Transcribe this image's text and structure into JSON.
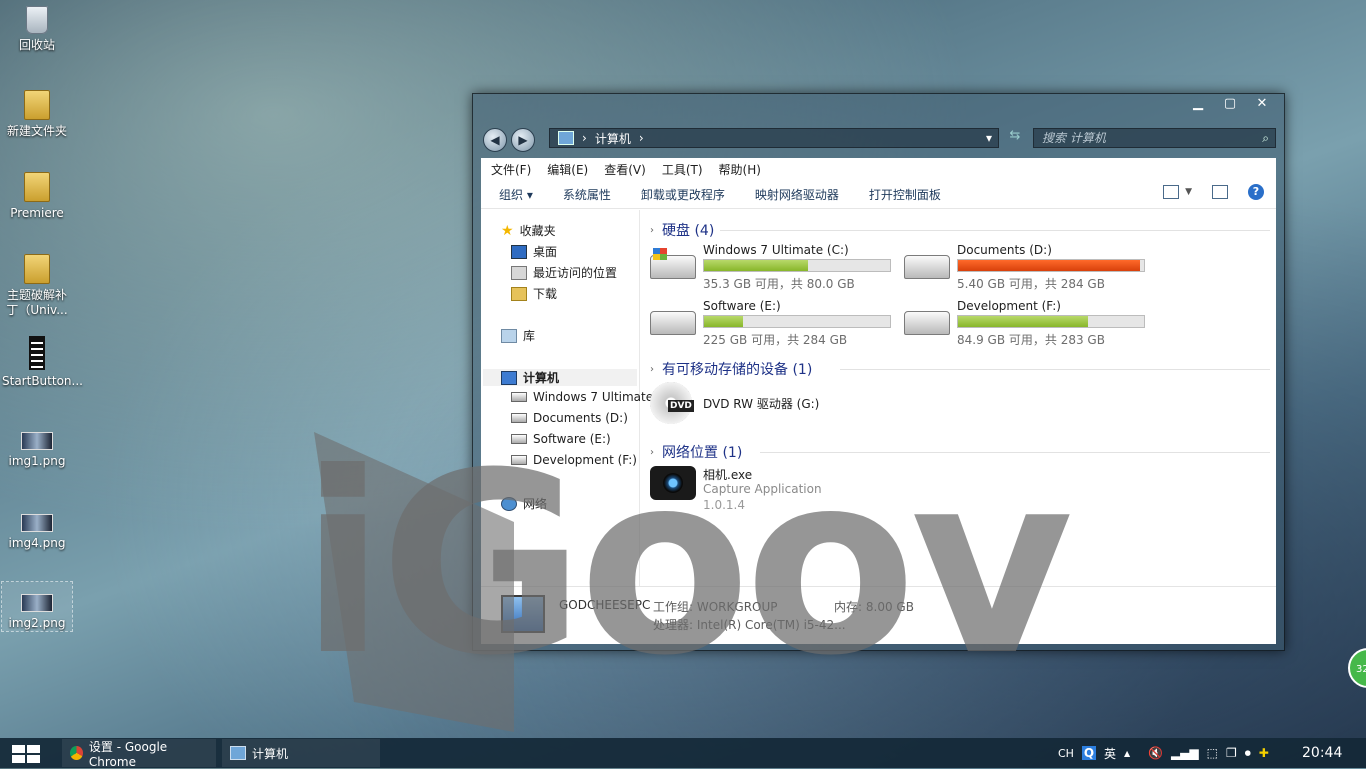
{
  "desktop": {
    "icons": [
      {
        "label": "回收站",
        "icon": "recycle-bin-icon"
      },
      {
        "label": "新建文件夹",
        "icon": "folder-icon"
      },
      {
        "label": "Premiere",
        "icon": "folder-icon"
      },
      {
        "label": "主题破解补丁（Univ...",
        "icon": "folder-icon"
      },
      {
        "label": "StartButton...",
        "icon": "film-icon"
      },
      {
        "label": "img1.png",
        "icon": "image-icon"
      },
      {
        "label": "img4.png",
        "icon": "image-icon"
      },
      {
        "label": "img2.png",
        "icon": "image-icon"
      }
    ],
    "watermark": "iGoov",
    "gauge_text": "32"
  },
  "window": {
    "caption": {
      "minimize": "▁",
      "maximize": "▢",
      "close": "✕"
    },
    "address": {
      "path": [
        "计算机"
      ],
      "separator": "›"
    },
    "search_placeholder": "搜索 计算机",
    "menu": [
      "文件(F)",
      "编辑(E)",
      "查看(V)",
      "工具(T)",
      "帮助(H)"
    ],
    "toolbar": [
      "组织 ▾",
      "系统属性",
      "卸载或更改程序",
      "映射网络驱动器",
      "打开控制面板"
    ],
    "help_label": "?",
    "nav": {
      "favorites": "收藏夹",
      "desktop": "桌面",
      "recent": "最近访问的位置",
      "downloads": "下载",
      "libraries": "库",
      "computer": "计算机",
      "drives": [
        "Windows 7 Ultimate",
        "Documents (D:)",
        "Software (E:)",
        "Development (F:)"
      ],
      "network": "网络"
    },
    "sections": {
      "hdd": "硬盘 (4)",
      "removable": "有可移动存储的设备 (1)",
      "network": "网络位置 (1)"
    },
    "drives": [
      {
        "name": "Windows 7 Ultimate (C:)",
        "free": "35.3 GB 可用，共 80.0 GB",
        "used_fraction": 0.56,
        "low": false
      },
      {
        "name": "Documents (D:)",
        "free": "5.40 GB 可用，共 284 GB",
        "used_fraction": 0.98,
        "low": true
      },
      {
        "name": "Software (E:)",
        "free": "225 GB 可用，共 284 GB",
        "used_fraction": 0.21,
        "low": false
      },
      {
        "name": "Development (F:)",
        "free": "84.9 GB 可用，共 283 GB",
        "used_fraction": 0.7,
        "low": false
      }
    ],
    "dvd": {
      "name": "DVD RW 驱动器 (G:)",
      "label": "DVD"
    },
    "network_item": {
      "name": "相机.exe",
      "desc": "Capture Application",
      "version": "1.0.1.4"
    },
    "details": {
      "pc_name": "GODCHEESEPC",
      "workgroup_label": "工作组:",
      "workgroup": "WORKGROUP",
      "memory_label": "内存:",
      "memory": "8.00 GB",
      "cpu_label": "处理器:",
      "cpu": "Intel(R) Core(TM) i5-42..."
    }
  },
  "taskbar": {
    "tasks": [
      {
        "label": "设置 - Google Chrome",
        "icon": "chrome-icon"
      },
      {
        "label": "计算机",
        "icon": "computer-icon"
      }
    ],
    "lang": "CH",
    "ime_q": "Q",
    "ime_en": "英",
    "time": "20:44"
  },
  "colors": {
    "drive_fill": "#88b62a",
    "drive_low": "#d8400b",
    "section_title": "#1e3287"
  }
}
